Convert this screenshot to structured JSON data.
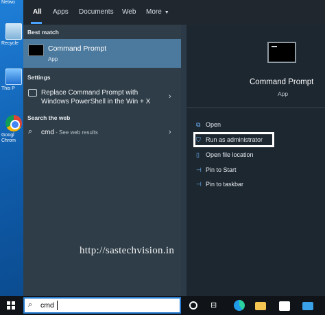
{
  "desktop": {
    "icons": [
      {
        "label": "Netwo"
      },
      {
        "label": "Recycle"
      },
      {
        "label": "This P"
      },
      {
        "label": "Googl Chrom"
      }
    ]
  },
  "tabs": {
    "all": "All",
    "apps": "Apps",
    "documents": "Documents",
    "web": "Web",
    "more": "More"
  },
  "results": {
    "best_match_header": "Best match",
    "best_match": {
      "title": "Command Prompt",
      "subtitle": "App"
    },
    "settings_header": "Settings",
    "setting_item": "Replace Command Prompt with Windows PowerShell in the Win + X",
    "web_header": "Search the web",
    "web_query": "cmd",
    "web_hint": " - See web results"
  },
  "details": {
    "title": "Command Prompt",
    "type": "App",
    "actions": {
      "open": "Open",
      "run_admin": "Run as administrator",
      "file_location": "Open file location",
      "pin_start": "Pin to Start",
      "pin_taskbar": "Pin to taskbar"
    }
  },
  "watermark": "http://sastechvision.in",
  "taskbar": {
    "search_value": "cmd"
  },
  "colors": {
    "accent": "#4aa3ff",
    "selected_row": "#4c7a9e",
    "highlight_box": "#ffffff"
  }
}
